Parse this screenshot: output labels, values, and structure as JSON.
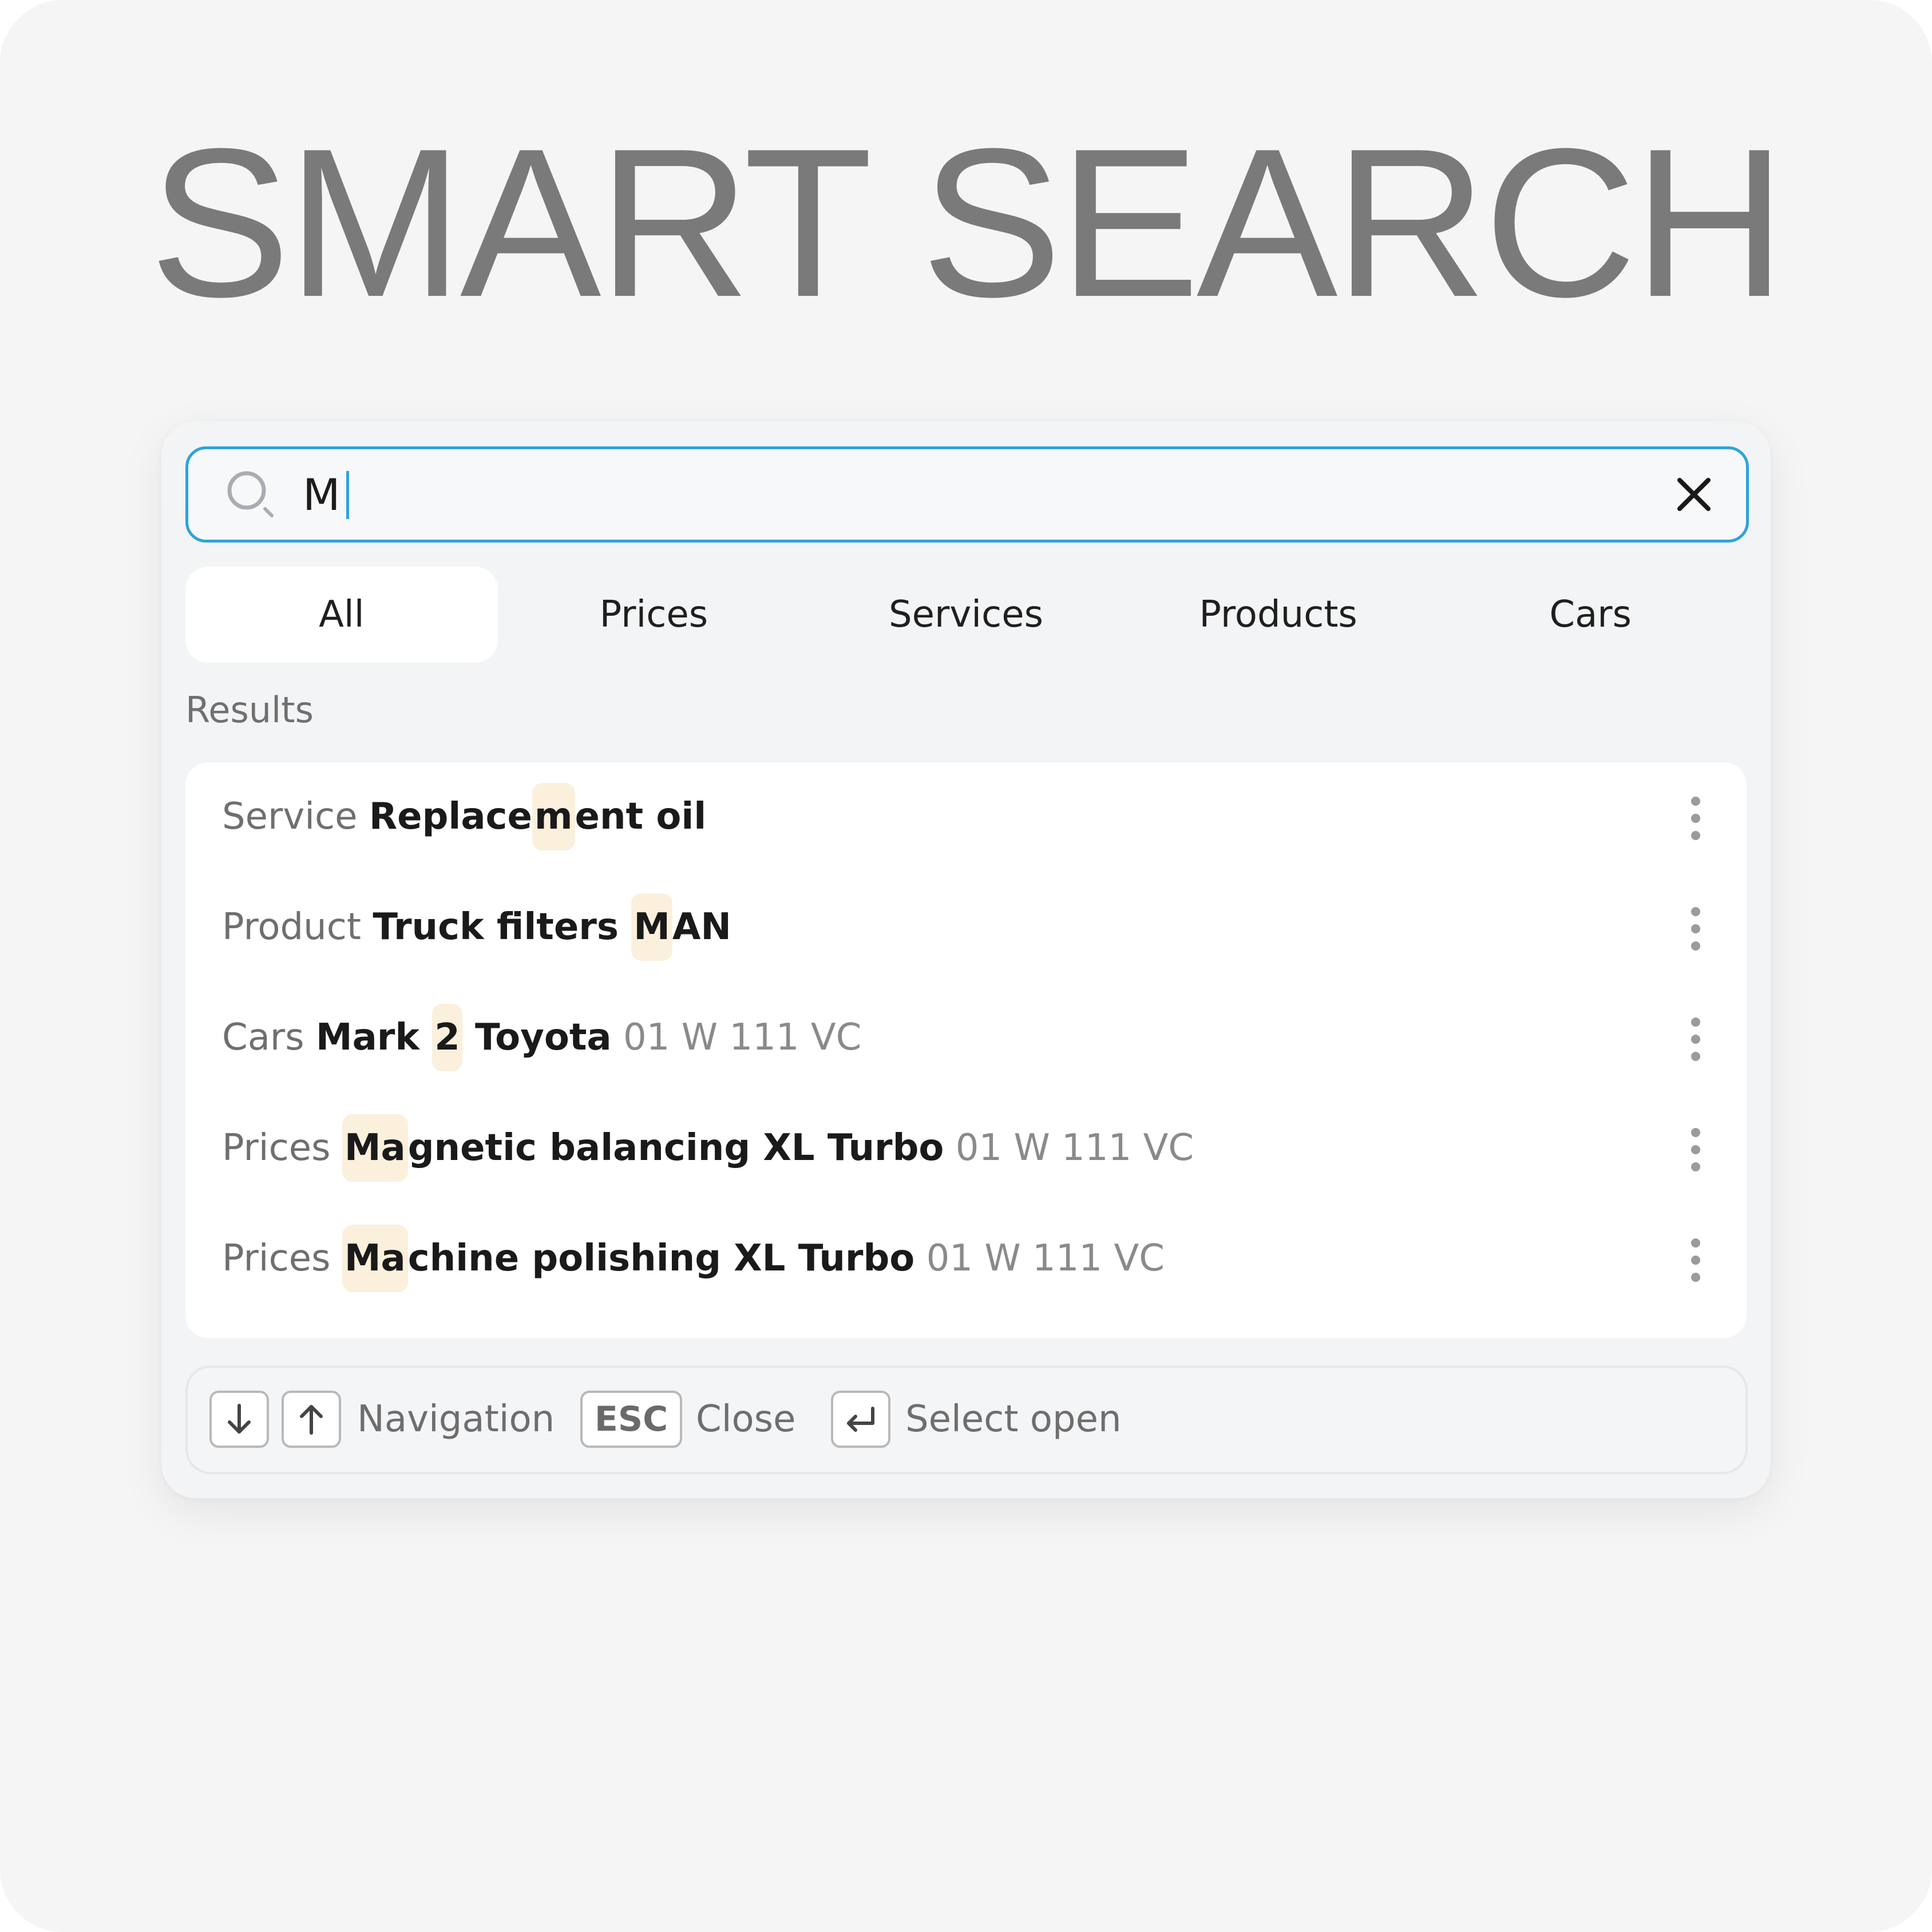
{
  "hero": {
    "title": "SMART SEARCH"
  },
  "search": {
    "query": "M"
  },
  "tabs": [
    {
      "label": "All",
      "active": true
    },
    {
      "label": "Prices",
      "active": false
    },
    {
      "label": "Services",
      "active": false
    },
    {
      "label": "Products",
      "active": false
    },
    {
      "label": "Cars",
      "active": false
    }
  ],
  "results_label": "Results",
  "results": [
    {
      "type": "Service",
      "name_parts": [
        "Replace",
        "m",
        "ent oil"
      ],
      "meta": ""
    },
    {
      "type": "Product",
      "name_parts": [
        "Truck filters ",
        "M",
        "AN"
      ],
      "meta": ""
    },
    {
      "type": "Cars",
      "name_parts": [
        "Mark ",
        "2",
        " Toyota"
      ],
      "meta": "01 W 111 VC"
    },
    {
      "type": "Prices",
      "name_parts": [
        "",
        "Ma",
        "gnetic balancing XL Turbo"
      ],
      "meta": "01 W 111 VC"
    },
    {
      "type": "Prices",
      "name_parts": [
        "",
        "Ma",
        "chine polishing XL Turbo"
      ],
      "meta": "01 W 111 VC"
    }
  ],
  "footer": {
    "navigation_label": "Navigation",
    "esc_key": "ESC",
    "close_label": "Close",
    "select_label": "Select open"
  },
  "colors": {
    "accent": "#2ea3dc",
    "highlight": "#faf0dc",
    "title": "#7a7a7a"
  },
  "icons": {
    "search": "search-icon",
    "clear": "close-icon",
    "more": "more-vertical-icon",
    "down": "arrow-down-icon",
    "up": "arrow-up-icon",
    "enter": "enter-icon"
  }
}
